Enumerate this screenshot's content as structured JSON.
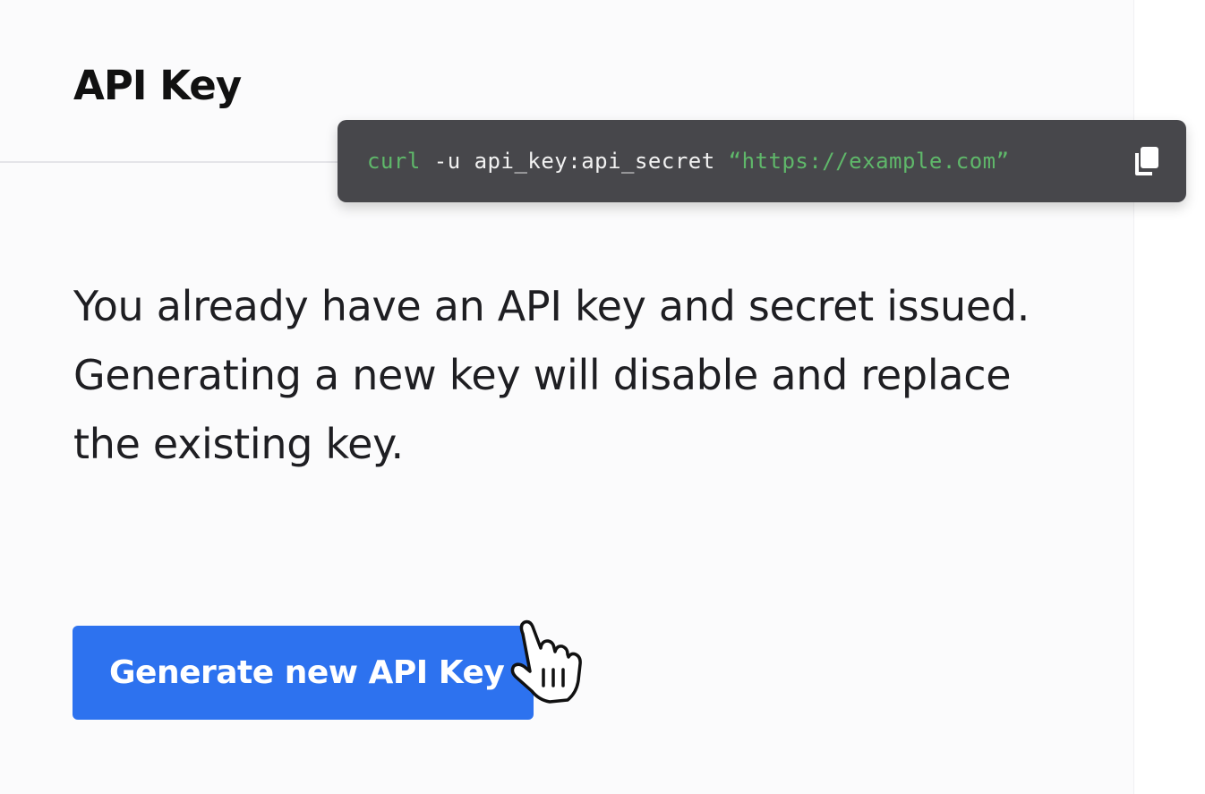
{
  "card": {
    "title": "API Key"
  },
  "code": {
    "command": "curl",
    "args": " -u api_key:api_secret ",
    "url": "“https://example.com”",
    "copy_icon": "copy-icon"
  },
  "description": "You already have an API key and secret issued. Generating a new key will disable and replace the existing key.",
  "actions": {
    "generate_label": "Generate new API Key"
  },
  "colors": {
    "accent": "#2d72ef",
    "code_bg": "#47474b",
    "code_green": "#5fb86a"
  },
  "cursor_icon": "hand-pointer-icon"
}
